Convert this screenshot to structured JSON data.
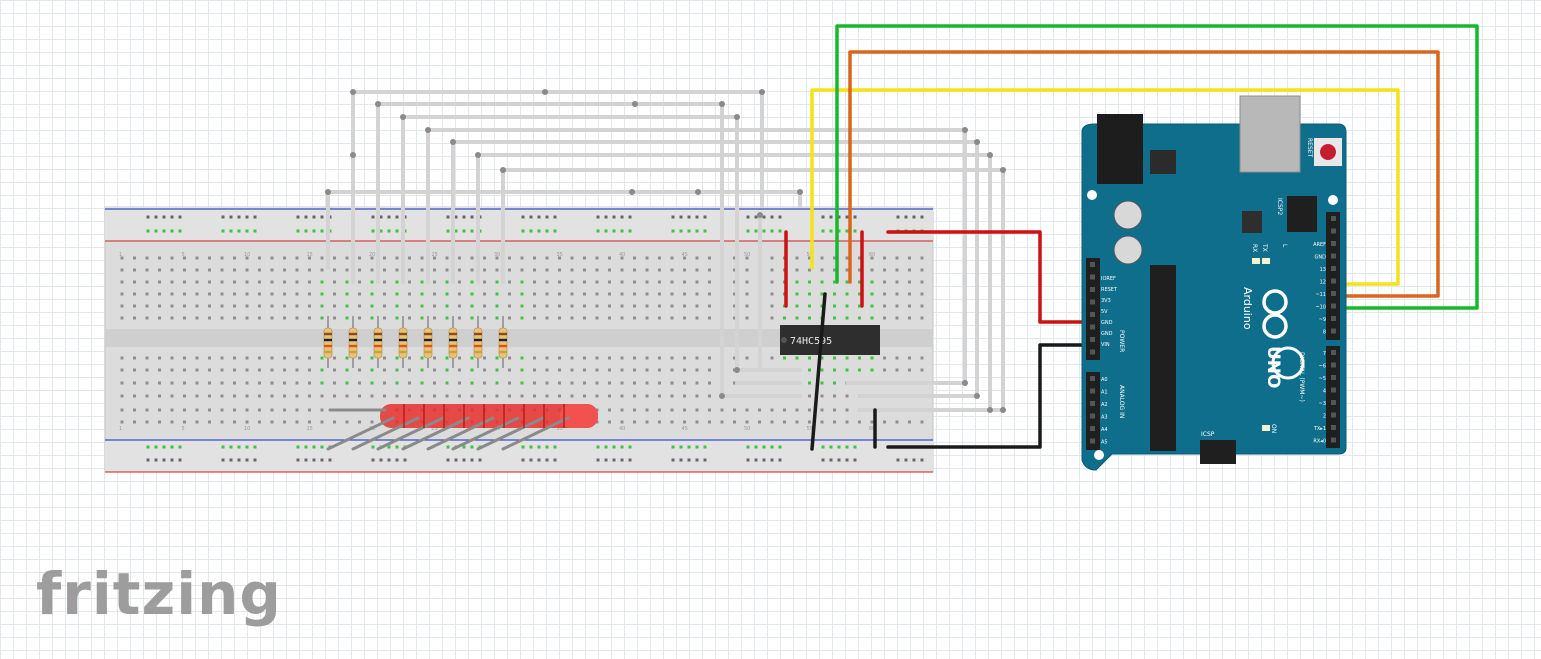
{
  "app": {
    "logo_text": "fritzing"
  },
  "breadboard": {
    "column_numbers": [
      "1",
      "5",
      "10",
      "15",
      "20",
      "25",
      "30",
      "35",
      "40",
      "45",
      "50",
      "55",
      "60"
    ]
  },
  "shift_register": {
    "label": "74HC595"
  },
  "arduino": {
    "brand": "Arduino",
    "model": "UNO",
    "reset_label": "RESET",
    "icsp2_label": "ICSP2",
    "icsp_label": "ICSP",
    "on_label": "ON",
    "tx_label": "TX",
    "rx_label": "RX",
    "l_label": "L",
    "power_label": "POWER",
    "analog_label": "ANALOG IN",
    "digital_label": "DIGITAL (PWM~)",
    "power_pins": [
      "IOREF",
      "RESET",
      "3V3",
      "5V",
      "GND",
      "GND",
      "VIN"
    ],
    "analog_pins": [
      "A0",
      "A1",
      "A2",
      "A3",
      "A4",
      "A5"
    ],
    "digital_top": [
      "AREF",
      "GND",
      "13",
      "12",
      "~11",
      "~10",
      "~9",
      "8"
    ],
    "digital_bottom": [
      "7",
      "~6",
      "~5",
      "4",
      "~3",
      "2",
      "TX▸1",
      "RX◂0"
    ]
  },
  "colors": {
    "wire_red": "#cc1111",
    "wire_black": "#1a1a1a",
    "wire_yellow": "#f2e418",
    "wire_orange": "#d9661b",
    "wire_green": "#16b82c",
    "wire_gray": "#d0d0d0",
    "board_blue": "#0f6e8c",
    "led_red": "#e8302e"
  }
}
